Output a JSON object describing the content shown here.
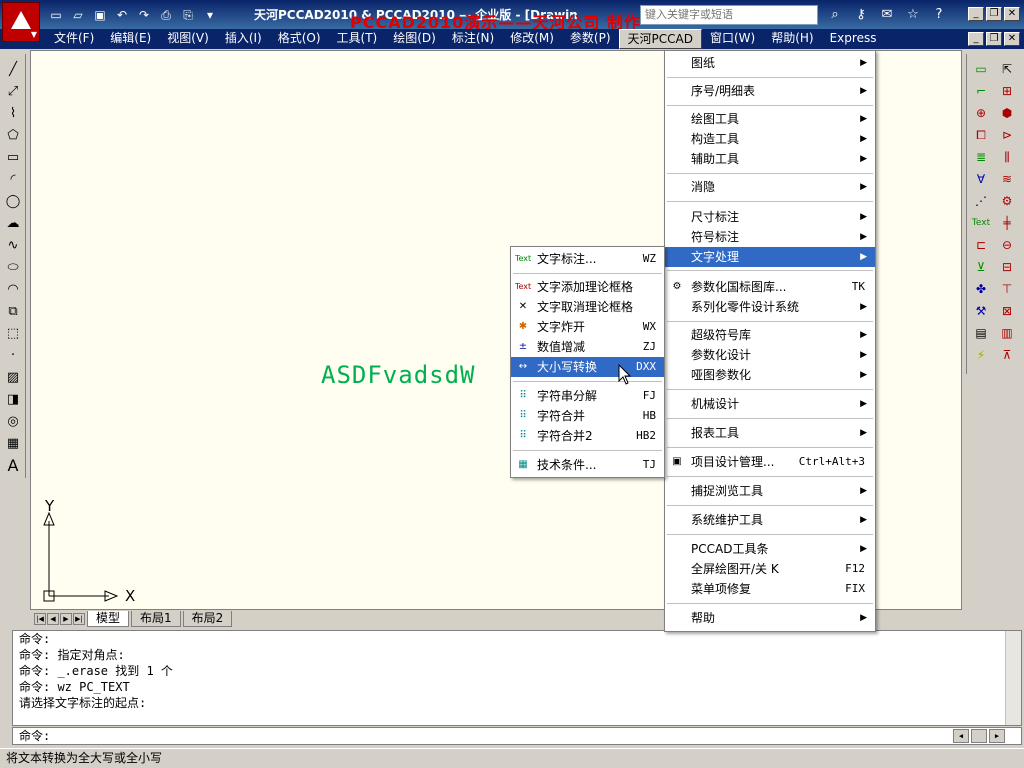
{
  "titlebar": {
    "title": "天河PCCAD2010 & PCCAD2010 — 企业版 - [Drawin",
    "overlay": "PCCAD2010演示——天河公司 制作",
    "search_placeholder": "键入关键字或短语"
  },
  "menubar": {
    "items": [
      "文件(F)",
      "编辑(E)",
      "视图(V)",
      "插入(I)",
      "格式(O)",
      "工具(T)",
      "绘图(D)",
      "标注(N)",
      "修改(M)",
      "参数(P)",
      "天河PCCAD",
      "窗口(W)",
      "帮助(H)",
      "Express"
    ]
  },
  "main_menu": {
    "items": [
      {
        "label": "图纸",
        "arrow": "▶"
      },
      {
        "label": "序号/明细表",
        "arrow": "▶"
      },
      {
        "label": "绘图工具",
        "arrow": "▶"
      },
      {
        "label": "构造工具",
        "arrow": "▶"
      },
      {
        "label": "辅助工具",
        "arrow": "▶"
      },
      {
        "label": "消隐",
        "arrow": "▶"
      },
      {
        "label": "尺寸标注",
        "arrow": "▶"
      },
      {
        "label": "符号标注",
        "arrow": "▶"
      },
      {
        "label": "文字处理",
        "arrow": "▶"
      },
      {
        "label": "参数化国标图库...",
        "shortcut": "TK"
      },
      {
        "label": "系列化零件设计系统",
        "arrow": "▶"
      },
      {
        "label": "超级符号库",
        "arrow": "▶"
      },
      {
        "label": "参数化设计",
        "arrow": "▶"
      },
      {
        "label": "哑图参数化",
        "arrow": "▶"
      },
      {
        "label": "机械设计",
        "arrow": "▶"
      },
      {
        "label": "报表工具",
        "arrow": "▶"
      },
      {
        "label": "项目设计管理...",
        "shortcut": "Ctrl+Alt+3"
      },
      {
        "label": "捕捉浏览工具",
        "arrow": "▶"
      },
      {
        "label": "系统维护工具",
        "arrow": "▶"
      },
      {
        "label": "PCCAD工具条",
        "arrow": "▶"
      },
      {
        "label": "全屏绘图开/关  K",
        "shortcut": "F12"
      },
      {
        "label": "菜单项修复",
        "shortcut": "FIX"
      },
      {
        "label": "帮助",
        "arrow": "▶"
      }
    ]
  },
  "sub_menu": {
    "items": [
      {
        "label": "文字标注...",
        "shortcut": "WZ",
        "icon": "Text"
      },
      {
        "label": "文字添加理论框格",
        "shortcut": "",
        "icon": "Text"
      },
      {
        "label": "文字取消理论框格",
        "shortcut": "",
        "icon": "✕"
      },
      {
        "label": "文字炸开",
        "shortcut": "WX",
        "icon": "✱"
      },
      {
        "label": "数值增减",
        "shortcut": "ZJ",
        "icon": "±"
      },
      {
        "label": "大小写转换",
        "shortcut": "DXX",
        "icon": "↔"
      },
      {
        "label": "字符串分解",
        "shortcut": "FJ",
        "icon": "⠿"
      },
      {
        "label": "字符合并",
        "shortcut": "HB",
        "icon": "⠿"
      },
      {
        "label": "字符合并2",
        "shortcut": "HB2",
        "icon": "⠿"
      },
      {
        "label": "技术条件...",
        "shortcut": "TJ",
        "icon": "▦"
      }
    ]
  },
  "canvas": {
    "text": "ASDFvadsdW",
    "axis_x": "X",
    "axis_y": "Y"
  },
  "layout_tabs": [
    "模型",
    "布局1",
    "布局2"
  ],
  "command": {
    "lines": [
      "命令:",
      "命令: 指定对角点:",
      "命令: _.erase 找到 1 个",
      "命令: wz PC_TEXT",
      "请选择文字标注的起点:"
    ],
    "prompt": "命令:"
  },
  "status": {
    "text": "将文本转换为全大写或全小写"
  },
  "colors": {
    "menubar_bg": "#0a246a",
    "highlight": "#316ac5",
    "canvas_bg": "#fffef0",
    "drawn_text": "#00b050",
    "overlay_text": "#e00000"
  }
}
